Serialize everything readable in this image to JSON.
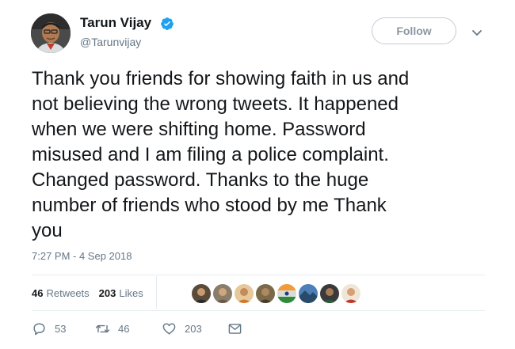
{
  "author": {
    "name": "Tarun Vijay",
    "handle": "@Tarunvijay"
  },
  "follow_label": "Follow",
  "tweet_text": "Thank you friends for showing faith in us and\nnot believing the wrong tweets. It happened\nwhen we were shifting home. Password\nmisused and I am filing a police complaint.\nChanged password. Thanks to the huge\nnumber of  friends who stood by me Thank\nyou",
  "timestamp": "7:27 PM - 4 Sep 2018",
  "stats": {
    "retweets_count": "46",
    "retweets_label": "Retweets",
    "likes_count": "203",
    "likes_label": "Likes"
  },
  "actions": {
    "reply_count": "53",
    "retweet_count": "46",
    "like_count": "203"
  },
  "icons": {
    "verified": "verified-badge-icon",
    "more": "chevron-down-icon",
    "reply": "reply-icon",
    "retweet": "retweet-icon",
    "like": "heart-icon",
    "message": "envelope-icon"
  },
  "colors": {
    "verified_blue": "#1da1f2",
    "text_primary": "#14171a",
    "text_secondary": "#657786",
    "follow_border": "#c5ccd3"
  }
}
